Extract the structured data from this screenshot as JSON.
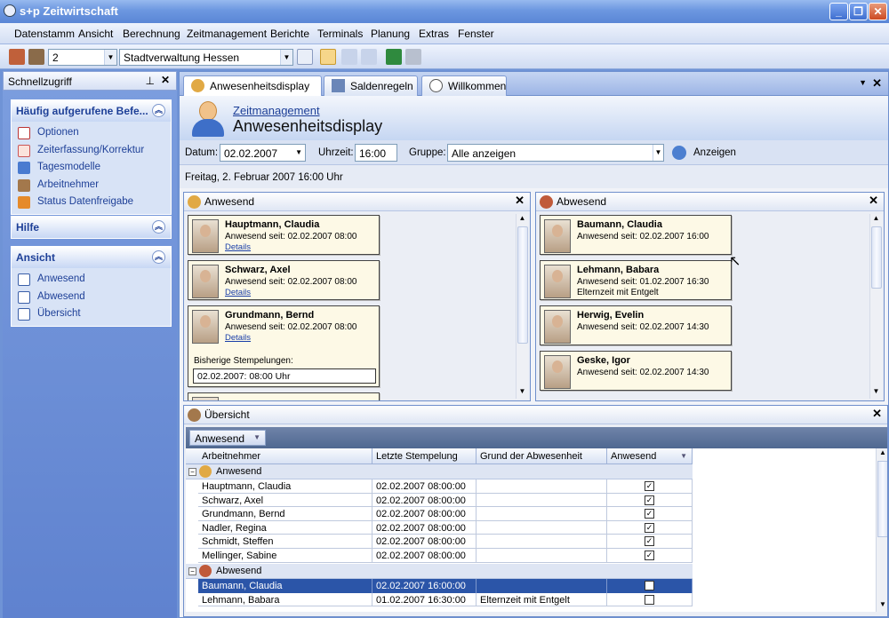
{
  "window": {
    "title": "s+p Zeitwirtschaft"
  },
  "menu": [
    "Datenstamm",
    "Ansicht",
    "Berechnung",
    "Zeitmanagement",
    "Berichte",
    "Terminals",
    "Planung",
    "Extras",
    "Fenster"
  ],
  "toolbar": {
    "mandant_value": "2",
    "organisation_value": "Stadtverwaltung Hessen"
  },
  "sidebar": {
    "title": "Schnellzugriff",
    "groups": [
      {
        "title": "Häufig aufgerufene Befe...",
        "items": [
          "Optionen",
          "Zeiterfassung/Korrektur",
          "Tagesmodelle",
          "Arbeitnehmer",
          "Status Datenfreigabe"
        ]
      },
      {
        "title": "Hilfe",
        "items": []
      },
      {
        "title": "Ansicht",
        "items": [
          "Anwesend",
          "Abwesend",
          "Übersicht"
        ]
      }
    ]
  },
  "tabs": [
    "Anwesenheitsdisplay",
    "Saldenregeln",
    "Willkommen"
  ],
  "banner": {
    "subtitle": "Zeitmanagement",
    "title": "Anwesenheitsdisplay"
  },
  "filter": {
    "datum_label": "Datum:",
    "datum_value": "02.02.2007",
    "uhrzeit_label": "Uhrzeit:",
    "uhrzeit_value": "16:00",
    "gruppe_label": "Gruppe:",
    "gruppe_value": "Alle anzeigen",
    "anzeigen_label": "Anzeigen"
  },
  "dateline": "Freitag, 2. Februar 2007 16:00 Uhr",
  "present_panel": {
    "title": "Anwesend",
    "cards": [
      {
        "name": "Hauptmann,  Claudia",
        "line1": "Anwesend seit: 02.02.2007 08:00",
        "link": "Details"
      },
      {
        "name": "Schwarz,  Axel",
        "line1": "Anwesend seit: 02.02.2007 08:00",
        "link": "Details"
      },
      {
        "name": "Grundmann,  Bernd",
        "line1": "Anwesend seit: 02.02.2007 08:00",
        "link": "Details",
        "stamps_label": "Bisherige Stempelungen:",
        "stamps_value": "02.02.2007: 08:00 Uhr"
      }
    ]
  },
  "absent_panel": {
    "title": "Abwesend",
    "cards": [
      {
        "name": "Baumann,  Claudia",
        "line1": "Anwesend seit: 02.02.2007 16:00"
      },
      {
        "name": "Lehmann,  Babara",
        "line1": "Anwesend seit: 01.02.2007 16:30",
        "line2": "Elternzeit mit Entgelt"
      },
      {
        "name": "Herwig,  Evelin",
        "line1": "Anwesend seit: 02.02.2007 14:30"
      },
      {
        "name": "Geske,  Igor",
        "line1": "Anwesend seit: 02.02.2007 14:30"
      }
    ]
  },
  "overview": {
    "title": "Übersicht",
    "group_button": "Anwesend",
    "columns": [
      "Arbeitnehmer",
      "Letzte Stempelung",
      "Grund der Abwesenheit",
      "Anwesend"
    ],
    "groups": [
      {
        "label": "Anwesend",
        "rows": [
          {
            "name": "Hauptmann, Claudia",
            "stamp": "02.02.2007 08:00:00",
            "reason": "",
            "present": true
          },
          {
            "name": "Schwarz, Axel",
            "stamp": "02.02.2007 08:00:00",
            "reason": "",
            "present": true
          },
          {
            "name": "Grundmann, Bernd",
            "stamp": "02.02.2007 08:00:00",
            "reason": "",
            "present": true
          },
          {
            "name": "Nadler, Regina",
            "stamp": "02.02.2007 08:00:00",
            "reason": "",
            "present": true
          },
          {
            "name": "Schmidt, Steffen",
            "stamp": "02.02.2007 08:00:00",
            "reason": "",
            "present": true
          },
          {
            "name": "Mellinger, Sabine",
            "stamp": "02.02.2007 08:00:00",
            "reason": "",
            "present": true
          }
        ]
      },
      {
        "label": "Abwesend",
        "rows": [
          {
            "name": "Baumann, Claudia",
            "stamp": "02.02.2007 16:00:00",
            "reason": "",
            "present": false,
            "selected": true
          },
          {
            "name": "Lehmann, Babara",
            "stamp": "01.02.2007 16:30:00",
            "reason": "Elternzeit mit Entgelt",
            "present": false
          }
        ]
      }
    ]
  },
  "colors": {
    "accent": "#1d3f97",
    "selection": "#2b55a8",
    "card_bg": "#fdf9e6"
  }
}
